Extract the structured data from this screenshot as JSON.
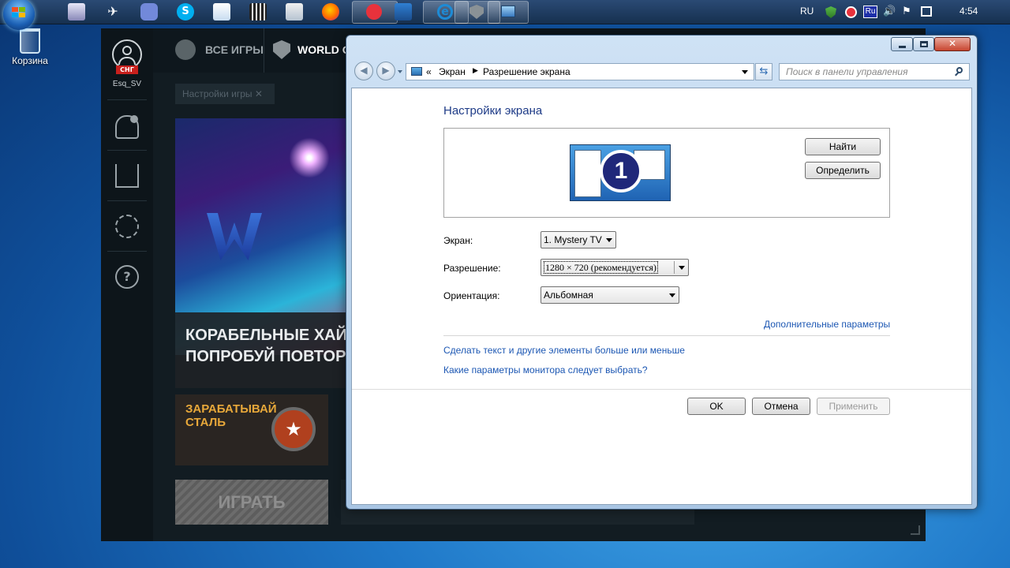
{
  "taskbar": {
    "tray": {
      "language": "RU",
      "keyboard": "Ru",
      "time": "4:54"
    }
  },
  "desktop": {
    "recycle_bin": "Корзина"
  },
  "launcher": {
    "username": "Esq_SV",
    "region_badge": "СНГ",
    "tab_all_games": "ВСЕ ИГРЫ",
    "tab_game": "WORLD OF",
    "settings_chip": "Настройки игры",
    "banner_line1": "КОРАБЕЛЬНЫЕ ХАЙЛ",
    "banner_line2": "ПОПРОБУЙ ПОВТОРИ",
    "earn_line1": "ЗАРАБАТЫВАЙ",
    "earn_line2": "СТАЛЬ",
    "play_button": "ИГРАТЬ"
  },
  "window": {
    "breadcrumb": {
      "chevrons": "«",
      "item1": "Экран",
      "item2": "Разрешение экрана"
    },
    "search_placeholder": "Поиск в панели управления",
    "title": "Настройки экрана",
    "monitor_number": "1",
    "detect_button": "Найти",
    "identify_button": "Определить",
    "display_label": "Экран:",
    "display_value": "1. Mystery TV",
    "resolution_label": "Разрешение:",
    "resolution_value": "1280 × 720 (рекомендуется)",
    "orientation_label": "Ориентация:",
    "orientation_value": "Альбомная",
    "advanced_link": "Дополнительные параметры",
    "text_size_link": "Сделать текст и другие элементы больше или меньше",
    "monitor_help_link": "Какие параметры монитора следует выбрать?",
    "ok_button": "OK",
    "cancel_button": "Отмена",
    "apply_button": "Применить"
  }
}
